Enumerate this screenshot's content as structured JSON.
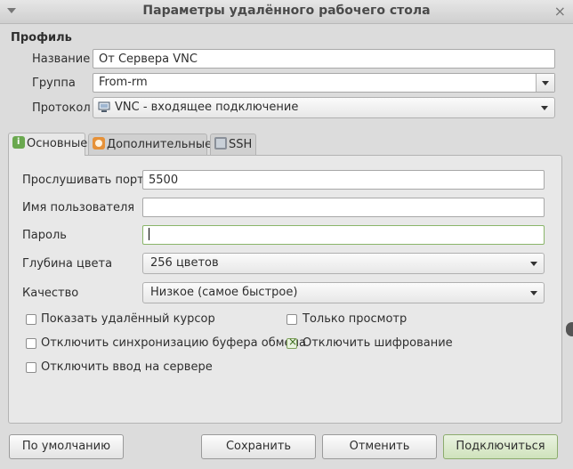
{
  "window": {
    "title": "Параметры удалённого рабочего стола",
    "close_glyph": "×"
  },
  "profile": {
    "section_title": "Профиль",
    "name_label": "Название",
    "name_value": "От Сервера VNC",
    "group_label": "Группа",
    "group_value": "From-rm",
    "protocol_label": "Протокол",
    "protocol_value": "VNC - входящее подключение"
  },
  "tabs": [
    {
      "label": "Основные",
      "icon": "info-icon",
      "active": true
    },
    {
      "label": "Дополнительные",
      "icon": "warning-icon",
      "active": false
    },
    {
      "label": "SSH",
      "icon": "terminal-icon",
      "active": false
    }
  ],
  "basic": {
    "port_label": "Прослушивать порт",
    "port_value": "5500",
    "user_label": "Имя пользователя",
    "user_value": "",
    "password_label": "Пароль",
    "password_value": "",
    "depth_label": "Глубина цвета",
    "depth_value": "256 цветов",
    "quality_label": "Качество",
    "quality_value": "Низкое (самое быстрое)"
  },
  "options": {
    "show_cursor": {
      "label": "Показать удалённый курсор",
      "checked": false
    },
    "view_only": {
      "label": "Только просмотр",
      "checked": false
    },
    "disable_clipboard": {
      "label": "Отключить синхронизацию буфера обмена",
      "checked": false
    },
    "disable_encryption": {
      "label": "Отключить шифрование",
      "checked": true
    },
    "disable_input": {
      "label": "Отключить ввод на сервере",
      "checked": false
    }
  },
  "buttons": {
    "default": "По умолчанию",
    "save": "Сохранить",
    "cancel": "Отменить",
    "connect": "Подключиться"
  },
  "colors": {
    "accent_green": "#8ab56a",
    "info_icon": "#6aa84f",
    "warning_icon": "#e69138"
  }
}
